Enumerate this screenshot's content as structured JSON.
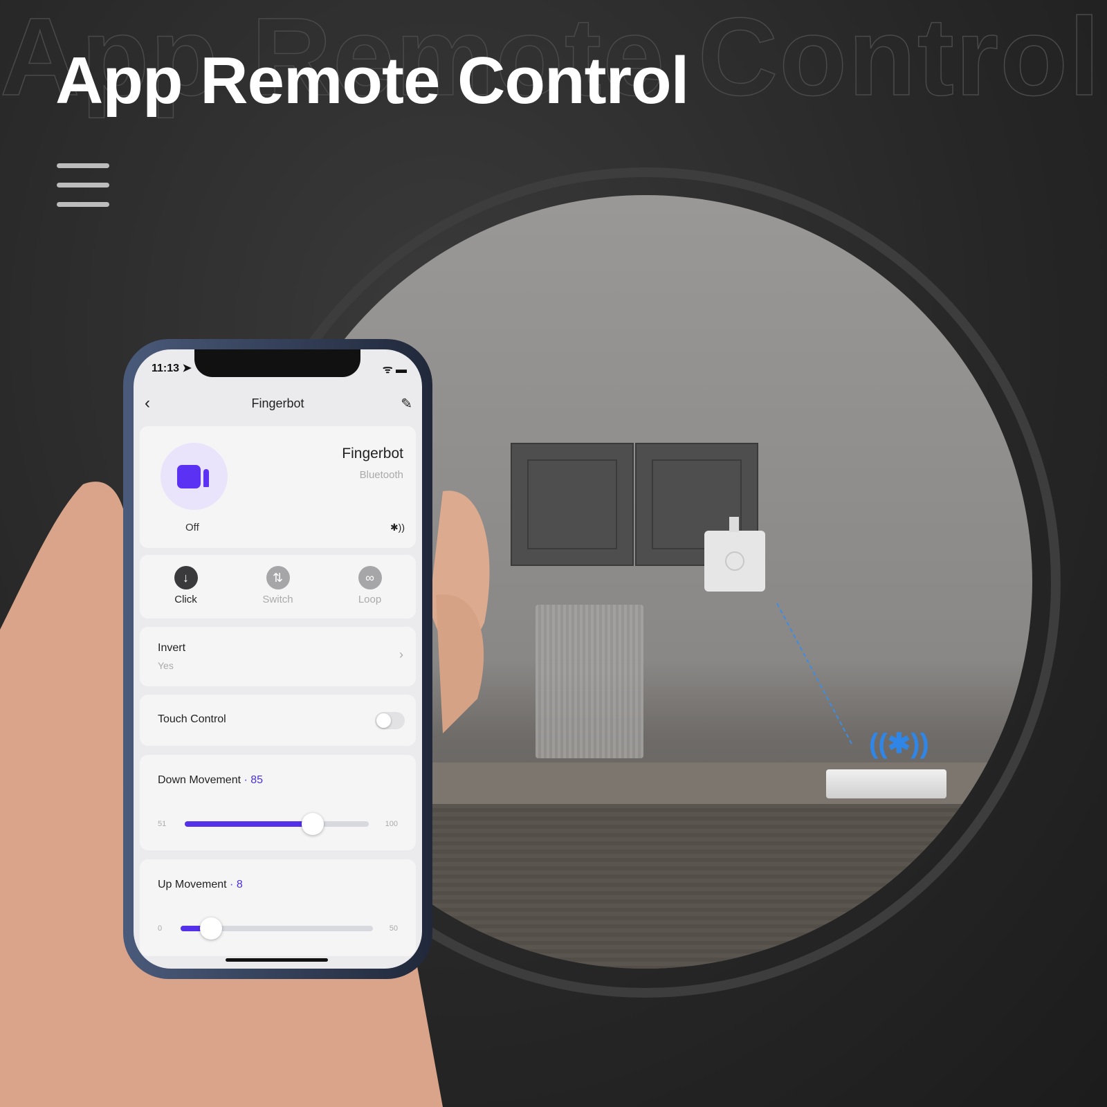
{
  "headline": "App Remote Control",
  "phone": {
    "status": {
      "time": "11:13 ➤",
      "icons": "ᯤ ▬"
    },
    "nav": {
      "title": "Fingerbot",
      "back": "‹",
      "edit": "✎"
    },
    "device": {
      "state": "Off",
      "name": "Fingerbot",
      "connection": "Bluetooth",
      "icon": "bluetooth-signal-icon",
      "icon_glyph": "✱))",
      "accent": "#5b32f4"
    },
    "modes": [
      {
        "label": "Click",
        "glyph": "↓",
        "active": true,
        "icon": "arrow-down-icon"
      },
      {
        "label": "Switch",
        "glyph": "⇅",
        "active": false,
        "icon": "swap-icon"
      },
      {
        "label": "Loop",
        "glyph": "∞",
        "active": false,
        "icon": "loop-icon"
      }
    ],
    "invert": {
      "label": "Invert",
      "value": "Yes",
      "chevron": "›"
    },
    "touch_control": {
      "label": "Touch Control",
      "enabled": false
    },
    "down_movement": {
      "label": "Down Movement",
      "sep": "·",
      "value": 85,
      "min": 51,
      "max": 100
    },
    "up_movement": {
      "label": "Up Movement",
      "sep": "·",
      "value": 8,
      "min": 0,
      "max": 50
    }
  },
  "scene": {
    "bluetooth_glyph": "((✱))"
  }
}
